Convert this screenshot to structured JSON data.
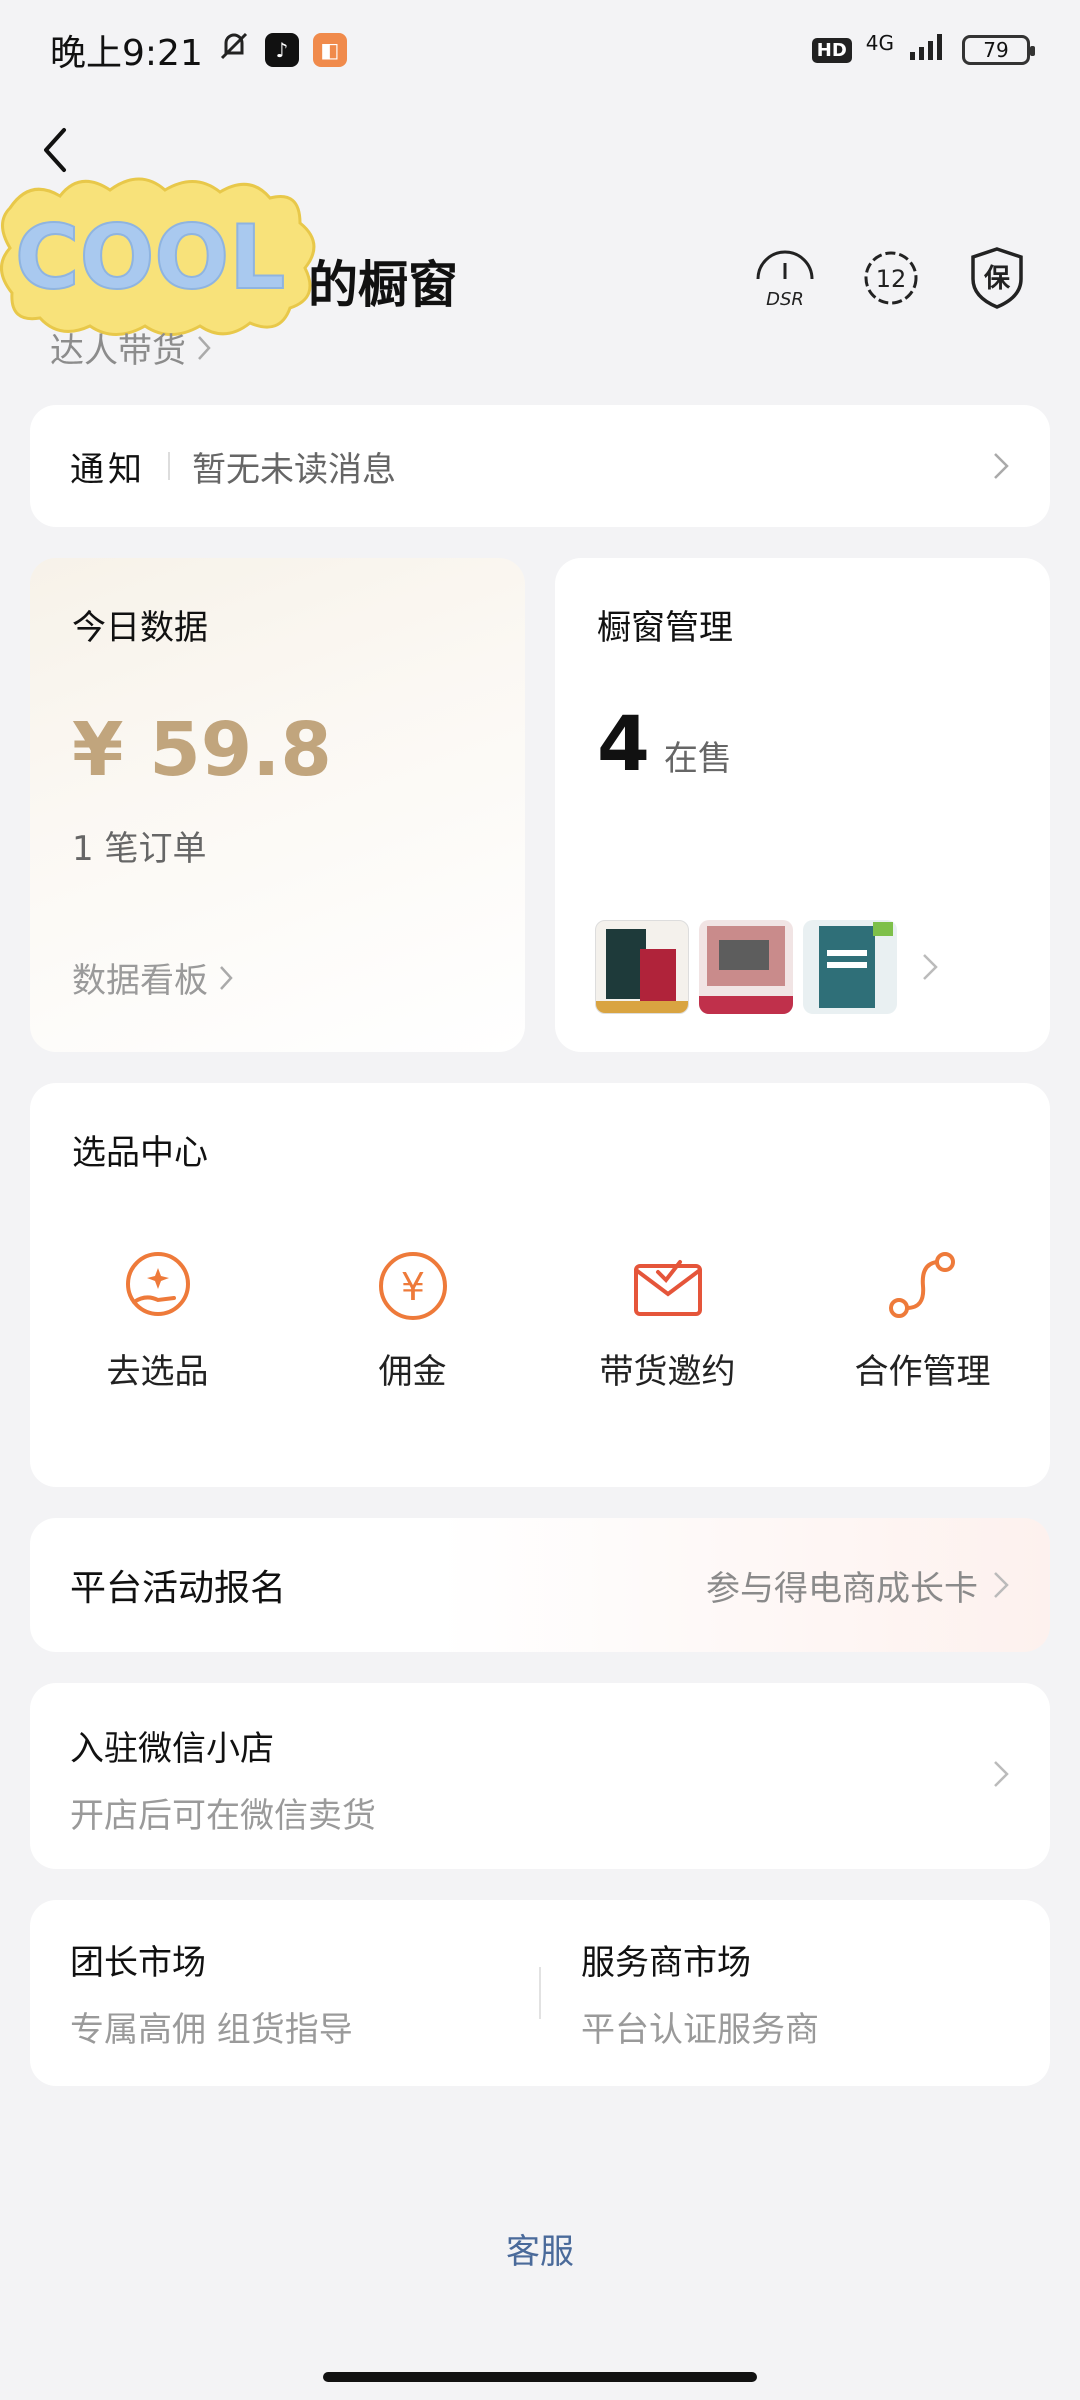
{
  "status_bar": {
    "time": "晚上9:21",
    "hd": "HD",
    "network": "4G",
    "battery": "79"
  },
  "header": {
    "sticker_text": "COOL",
    "title": "的橱窗",
    "sub_link": "达人带货",
    "icons": {
      "dsr_label": "DSR",
      "level": "12",
      "guarantee": "保"
    }
  },
  "notice": {
    "title": "通知",
    "message": "暂无未读消息"
  },
  "today": {
    "title": "今日数据",
    "amount": "¥ 59.8",
    "orders": "1 笔订单",
    "link": "数据看板"
  },
  "shop": {
    "title": "橱窗管理",
    "count": "4",
    "count_label": "在售"
  },
  "select_center": {
    "title": "选品中心",
    "items": [
      {
        "label": "去选品",
        "icon": "select-product-icon"
      },
      {
        "label": "佣金",
        "icon": "commission-icon"
      },
      {
        "label": "带货邀约",
        "icon": "invite-icon"
      },
      {
        "label": "合作管理",
        "icon": "cooperation-icon"
      }
    ]
  },
  "activity": {
    "title": "平台活动报名",
    "link": "参与得电商成长卡"
  },
  "wechat": {
    "title": "入驻微信小店",
    "subtitle": "开店后可在微信卖货"
  },
  "markets": [
    {
      "title": "团长市场",
      "subtitle": "专属高佣 组货指导"
    },
    {
      "title": "服务商市场",
      "subtitle": "平台认证服务商"
    }
  ],
  "footer": {
    "service": "客服"
  },
  "colors": {
    "accent_gold": "#c1a57d",
    "icon_orange": "#ee7a3a",
    "link_blue": "#4a6a9a"
  }
}
